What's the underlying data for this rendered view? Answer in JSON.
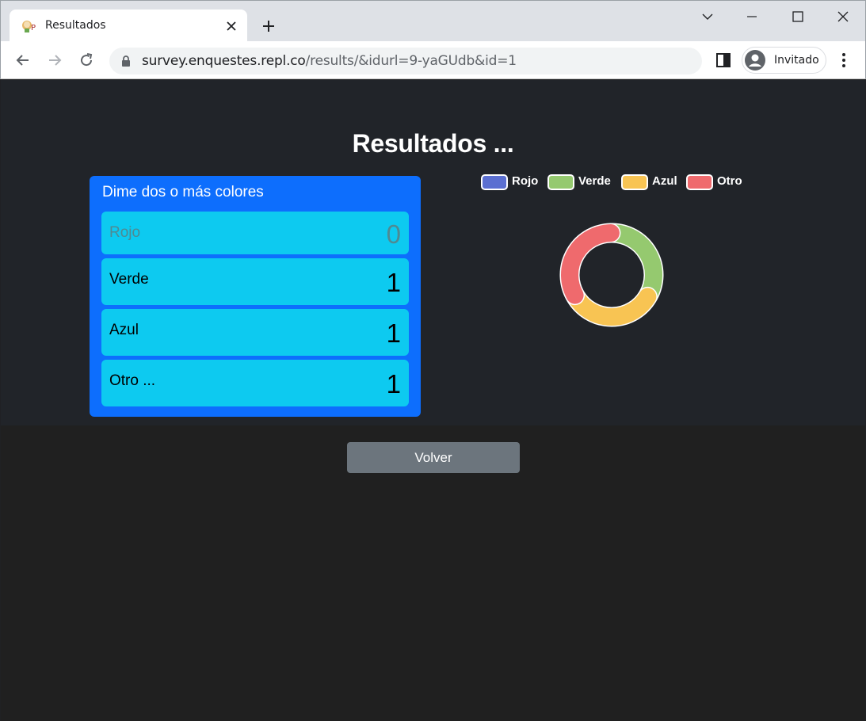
{
  "browser": {
    "tab_title": "Resultados",
    "url_host": "survey.enquestes.repl.co",
    "url_path": "/results/&idurl=9-yaGUdb&id=1",
    "profile_label": "Invitado"
  },
  "page": {
    "title": "Resultados ...",
    "back_label": "Volver"
  },
  "question": {
    "title": "Dime dos o más colores",
    "options": [
      {
        "label": "Rojo",
        "count": "0"
      },
      {
        "label": "Verde",
        "count": "1"
      },
      {
        "label": "Azul",
        "count": "1"
      },
      {
        "label": "Otro ...",
        "count": "1"
      }
    ]
  },
  "chart_data": {
    "type": "pie",
    "variant": "doughnut",
    "categories": [
      "Rojo",
      "Verde",
      "Azul",
      "Otro"
    ],
    "values": [
      0,
      1,
      1,
      1
    ],
    "colors": [
      "#5b6fd1",
      "#95c96f",
      "#f8c453",
      "#ef6a6d"
    ],
    "legend_position": "top"
  },
  "colors": {
    "card": "#0d6efd",
    "option": "#0dcaf0",
    "button": "#6c757d"
  }
}
